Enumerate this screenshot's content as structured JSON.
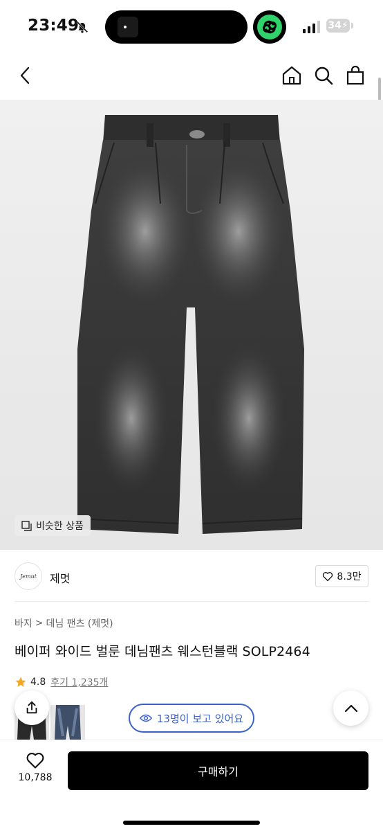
{
  "status_bar": {
    "time": "23:49",
    "battery": "34",
    "icons": [
      "bell-slash-icon",
      "app-chain-icon",
      "signal-icon",
      "battery-icon"
    ]
  },
  "nav": {
    "icons": [
      "back-chevron-icon",
      "home-icon",
      "search-icon",
      "shopping-bag-icon"
    ]
  },
  "hero": {
    "similar_products_label": "비슷한 상품",
    "image_alt": "jeans-product-image"
  },
  "brand": {
    "logo_text": "Jemut",
    "name": "제멋",
    "likes": "8.3만"
  },
  "breadcrumb": {
    "category": "바지",
    "separator": ">",
    "subcategory": "데님 팬츠 (제멋)"
  },
  "product": {
    "title": "베이퍼 와이드 벌룬 데님팬츠 웨스턴블랙 SOLP2464",
    "rating": "4.8",
    "reviews": "후기 1,235개"
  },
  "viewers_label": "13명이 보고 있어요",
  "bottom": {
    "wish_count": "10,788",
    "buy_label": "구매하기"
  },
  "colors": {
    "accent_blue": "#3b63c9",
    "star": "#f5a623",
    "buy_button": "#000000"
  }
}
